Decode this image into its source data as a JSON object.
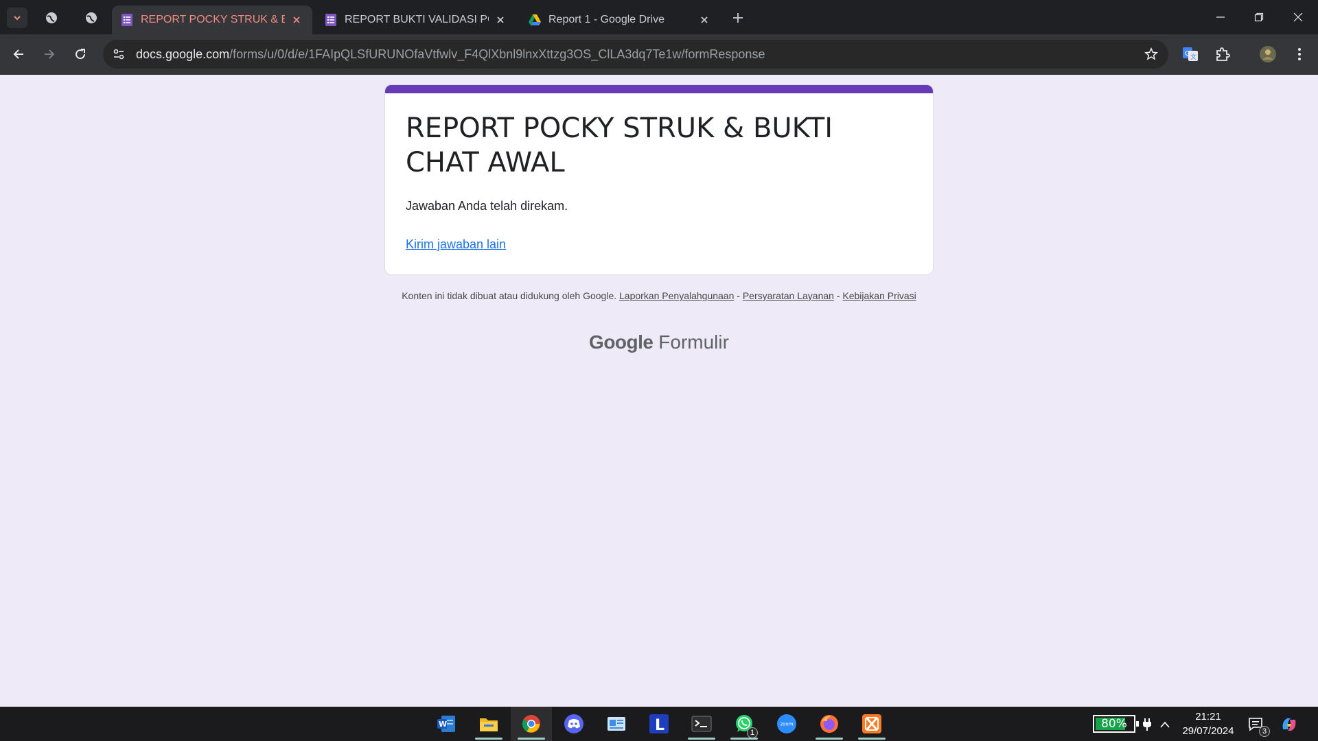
{
  "browser": {
    "tabs": [
      {
        "title": "REPORT POCKY STRUK & BUKTI CHAT AWAL",
        "active": true,
        "icon": "google-forms-icon"
      },
      {
        "title": "REPORT BUKTI VALIDASI POCKY",
        "active": false,
        "icon": "google-forms-icon"
      },
      {
        "title": "Report 1 - Google Drive",
        "active": false,
        "icon": "google-drive-icon"
      }
    ],
    "url_host": "docs.google.com",
    "url_path": "/forms/u/0/d/e/1FAIpQLSfURUNOfaVtfwlv_F4QlXbnl9lnxXttzg3OS_ClLA3dq7Te1w/formResponse"
  },
  "form": {
    "title": "REPORT POCKY STRUK & BUKTI CHAT AWAL",
    "confirmation": "Jawaban Anda telah direkam.",
    "submit_another": "Kirim jawaban lain",
    "accent_color": "#673ab7"
  },
  "footer": {
    "disclaimer": "Konten ini tidak dibuat atau didukung oleh Google.",
    "report_abuse": "Laporkan Penyalahgunaan",
    "terms": "Persyaratan Layanan",
    "privacy": "Kebijakan Privasi",
    "separator": "-",
    "brand_google": "Google",
    "brand_product": "Formulir"
  },
  "taskbar": {
    "apps": [
      "word",
      "file-explorer",
      "chrome",
      "discord",
      "news",
      "l-app",
      "terminal",
      "whatsapp",
      "zoom",
      "firefox",
      "xampp"
    ],
    "whatsapp_badge": "1",
    "zoom_label": "zoom",
    "battery_percent": "80%",
    "battery_level": 0.8,
    "time": "21:21",
    "date": "29/07/2024",
    "notifications": "3"
  }
}
